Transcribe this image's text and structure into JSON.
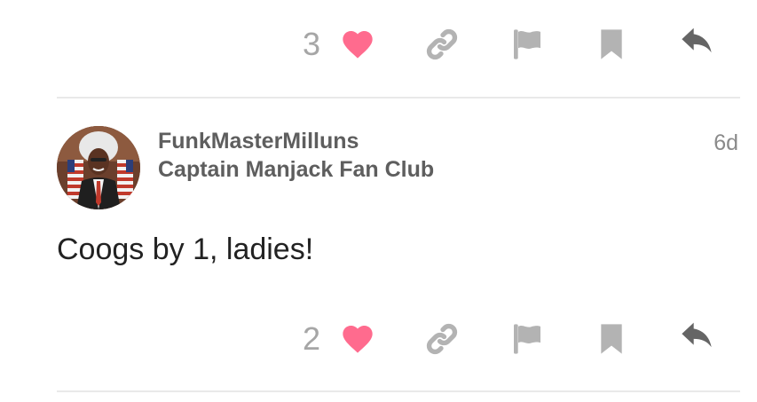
{
  "previous_post": {
    "like_count": "3"
  },
  "post": {
    "username": "FunkMasterMilluns",
    "group": "Captain Manjack Fan Club",
    "age": "6d",
    "body": "Coogs by 1, ladies!",
    "like_count": "2"
  },
  "icons": {
    "like": "heart-icon",
    "share": "link-icon",
    "flag": "flag-icon",
    "bookmark": "bookmark-icon",
    "reply": "reply-icon"
  },
  "colors": {
    "heart": "#ff6b8e",
    "muted_icon": "#b3b3b3",
    "reply_icon": "#656565",
    "text_muted": "#a6a6a6",
    "name": "#5e5e5e",
    "body": "#222222",
    "divider": "#e9e9e9"
  }
}
